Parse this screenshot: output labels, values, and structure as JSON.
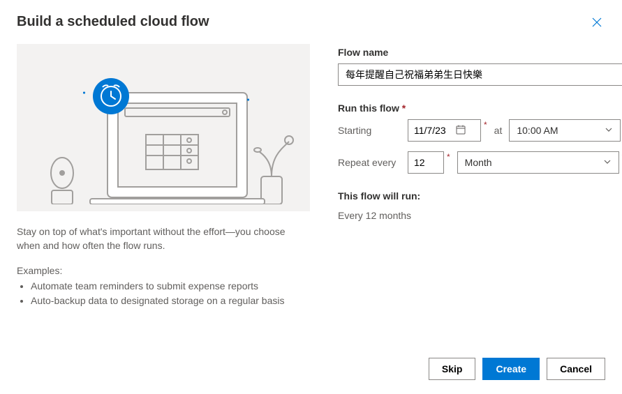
{
  "header": {
    "title": "Build a scheduled cloud flow"
  },
  "left": {
    "description": "Stay on top of what's important without the effort—you choose when and how often the flow runs.",
    "examples_label": "Examples:",
    "examples": [
      "Automate team reminders to submit expense reports",
      "Auto-backup data to designated storage on a regular basis"
    ]
  },
  "form": {
    "flow_name_label": "Flow name",
    "flow_name_value": "每年提醒自己祝福弟弟生日快樂",
    "run_label": "Run this flow",
    "starting_label": "Starting",
    "starting_date": "11/7/23",
    "at_label": "at",
    "starting_time": "10:00 AM",
    "repeat_label": "Repeat every",
    "repeat_value": "12",
    "repeat_unit": "Month",
    "summary_label": "This flow will run:",
    "summary_text": "Every 12 months"
  },
  "footer": {
    "skip": "Skip",
    "create": "Create",
    "cancel": "Cancel"
  }
}
